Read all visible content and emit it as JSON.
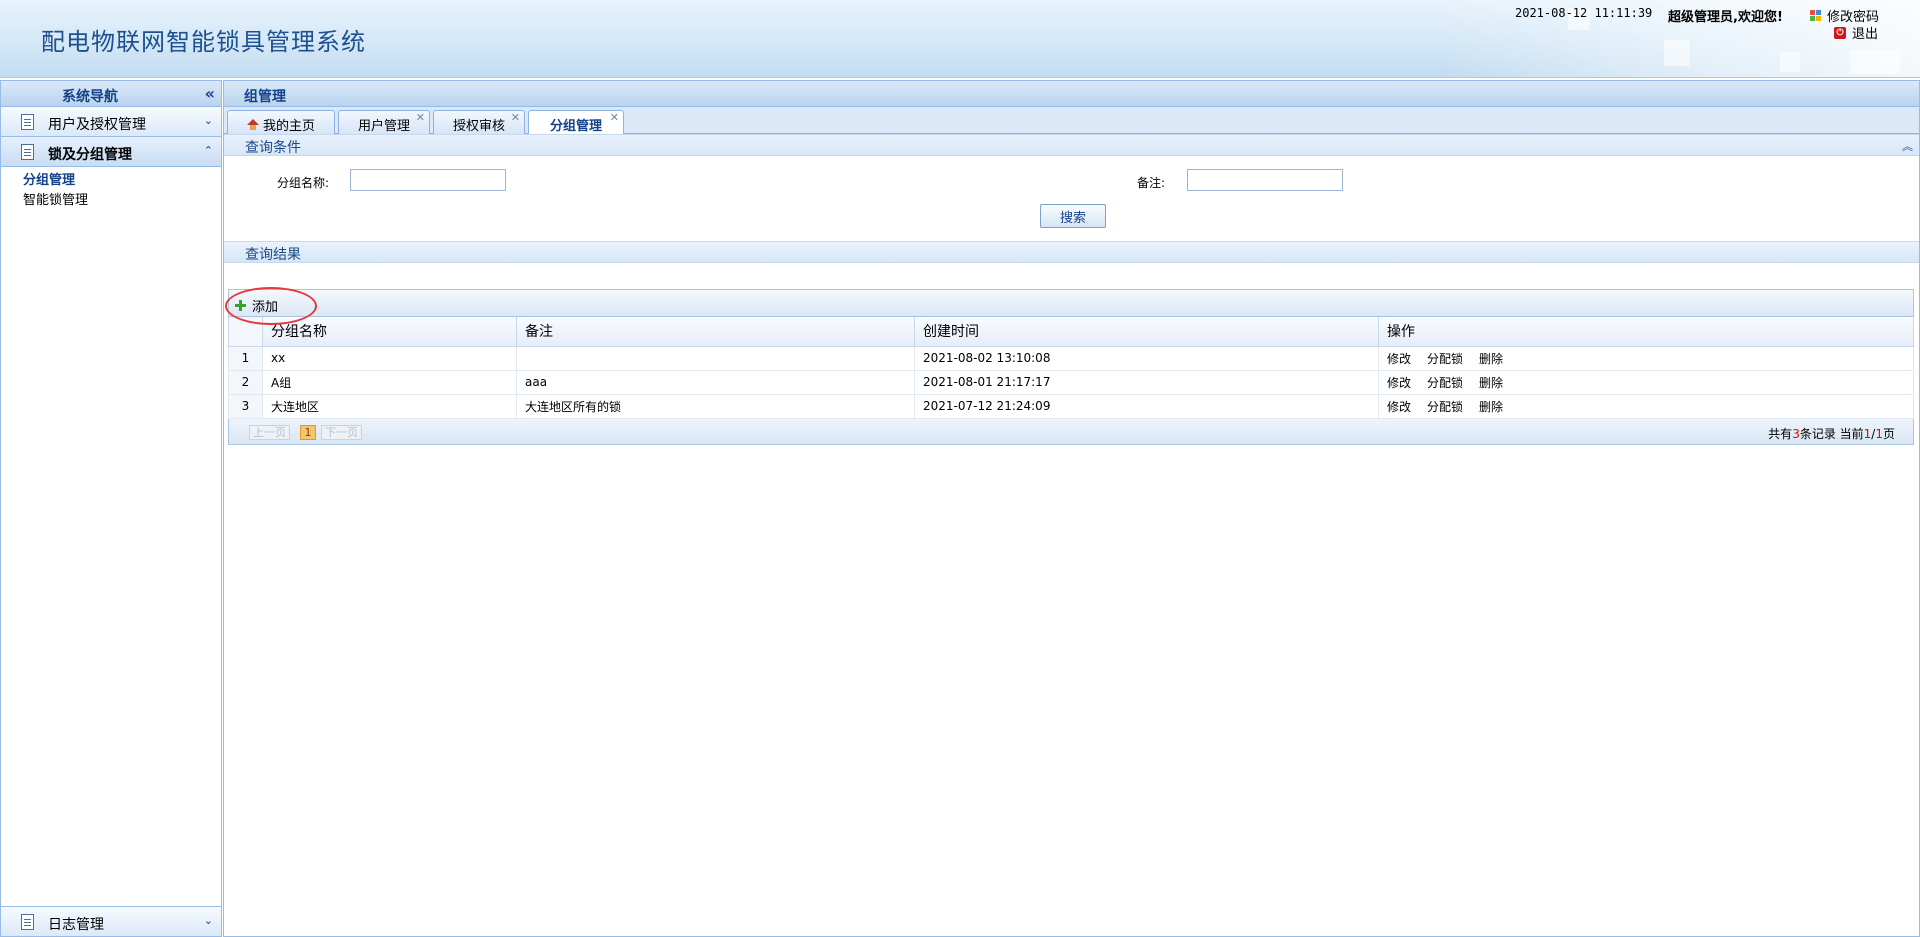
{
  "header": {
    "title": "配电物联网智能锁具管理系统",
    "datetime": "2021-08-12 11:11:39",
    "welcome": "超级管理员,欢迎您!",
    "change_password": "修改密码",
    "logout": "退出"
  },
  "sidebar": {
    "title": "系统导航",
    "collapse_icon": "«",
    "sections": [
      {
        "label": "用户及授权管理"
      },
      {
        "label": "锁及分组管理",
        "items": [
          "分组管理",
          "智能锁管理"
        ]
      },
      {
        "label": "日志管理"
      }
    ]
  },
  "main": {
    "title": "组管理",
    "tabs": [
      {
        "label": "我的主页"
      },
      {
        "label": "用户管理"
      },
      {
        "label": "授权审核"
      },
      {
        "label": "分组管理"
      }
    ],
    "query": {
      "heading": "查询条件",
      "group_name_label": "分组名称:",
      "group_name_value": "",
      "remark_label": "备注:",
      "remark_value": "",
      "search_button": "搜索"
    },
    "results": {
      "heading": "查询结果",
      "add_button": "添加",
      "columns": [
        "分组名称",
        "备注",
        "创建时间",
        "操作"
      ],
      "rows": [
        {
          "no": "1",
          "name": "xx",
          "remark": "",
          "created": "2021-08-02 13:10:08"
        },
        {
          "no": "2",
          "name": "A组",
          "remark": "aaa",
          "created": "2021-08-01 21:17:17"
        },
        {
          "no": "3",
          "name": "大连地区",
          "remark": "大连地区所有的锁",
          "created": "2021-07-12 21:24:09"
        }
      ],
      "row_actions": [
        "修改",
        "分配锁",
        "删除"
      ]
    },
    "pager": {
      "prev": "上一页",
      "current_page": "1",
      "next": "下一页",
      "summary_prefix": "共有",
      "total_records": "3",
      "summary_mid": "条记录 当前",
      "current": "1",
      "slash": "/",
      "total_pages": "1",
      "summary_suffix": "页"
    }
  },
  "colors": {
    "accent": "#15428b",
    "border": "#99bbe8",
    "highlight_circle": "#e53935"
  }
}
